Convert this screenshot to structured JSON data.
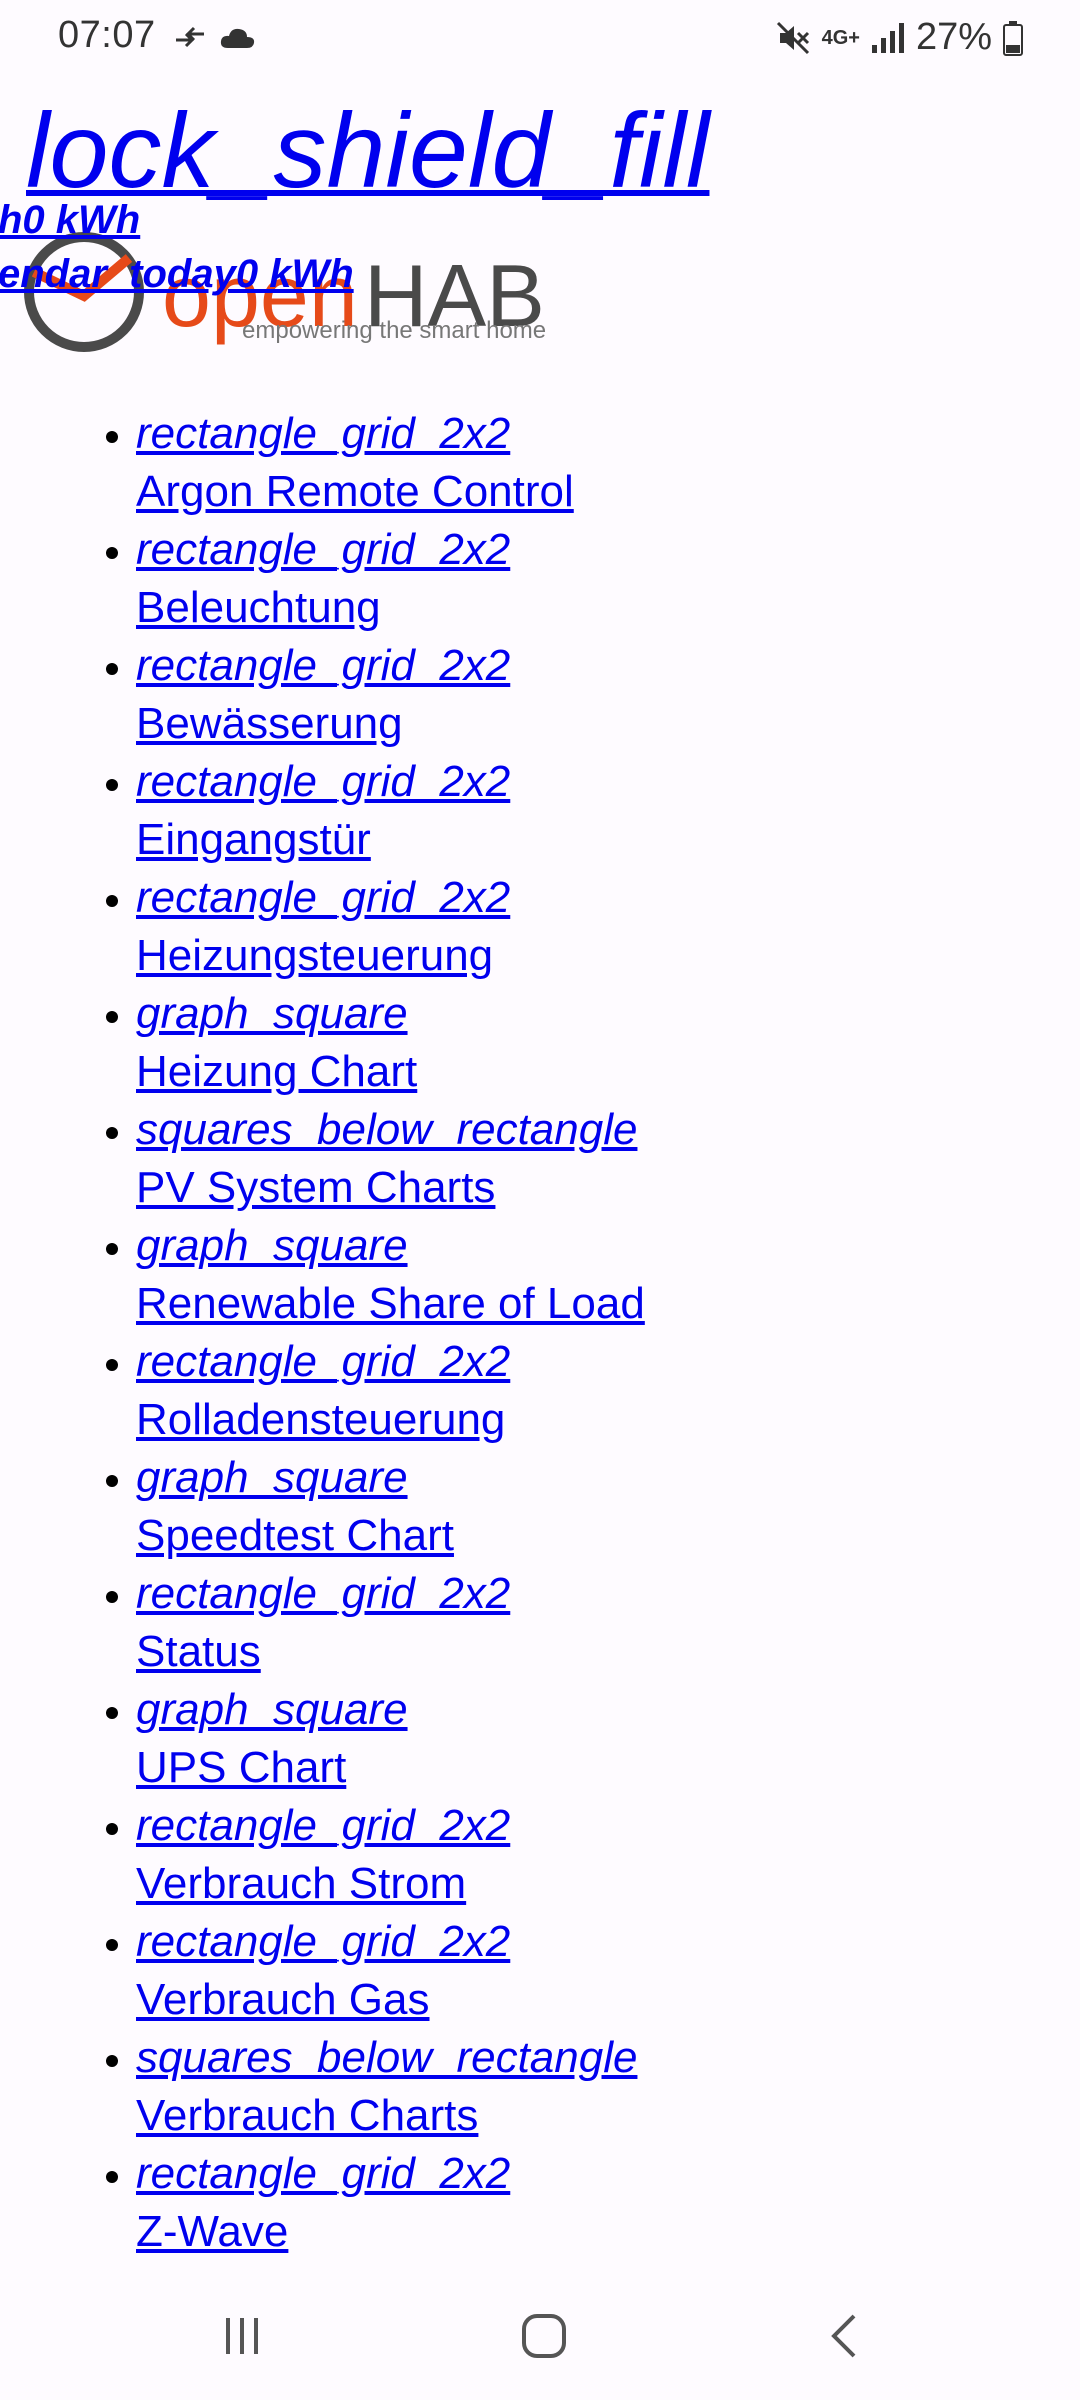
{
  "status_bar": {
    "time": "07:07",
    "battery": "27%",
    "network": "4G+"
  },
  "header": {
    "title": "lock_shield_fill",
    "energy_1": "h0 kWh",
    "energy_2": "endar_today0 kWh"
  },
  "logo": {
    "brand_open": "open",
    "brand_hab": "HAB",
    "tagline": "empowering the smart home",
    "accent_color": "#e64a19",
    "dark_color": "#4a4a4a"
  },
  "menu": [
    {
      "icon": "rectangle_grid_2x2",
      "label": "Argon Remote Control"
    },
    {
      "icon": "rectangle_grid_2x2",
      "label": "Beleuchtung"
    },
    {
      "icon": "rectangle_grid_2x2",
      "label": "Bewässerung"
    },
    {
      "icon": "rectangle_grid_2x2",
      "label": "Eingangstür"
    },
    {
      "icon": "rectangle_grid_2x2",
      "label": "Heizungsteuerung"
    },
    {
      "icon": "graph_square",
      "label": "Heizung Chart"
    },
    {
      "icon": "squares_below_rectangle",
      "label": "PV System Charts"
    },
    {
      "icon": "graph_square",
      "label": "Renewable Share of Load"
    },
    {
      "icon": "rectangle_grid_2x2",
      "label": "Rolladensteuerung"
    },
    {
      "icon": "graph_square",
      "label": "Speedtest Chart"
    },
    {
      "icon": "rectangle_grid_2x2",
      "label": "Status"
    },
    {
      "icon": "graph_square",
      "label": "UPS Chart"
    },
    {
      "icon": "rectangle_grid_2x2",
      "label": "Verbrauch Strom"
    },
    {
      "icon": "rectangle_grid_2x2",
      "label": "Verbrauch Gas"
    },
    {
      "icon": "squares_below_rectangle",
      "label": "Verbrauch Charts"
    },
    {
      "icon": "rectangle_grid_2x2",
      "label": "Z-Wave"
    }
  ]
}
